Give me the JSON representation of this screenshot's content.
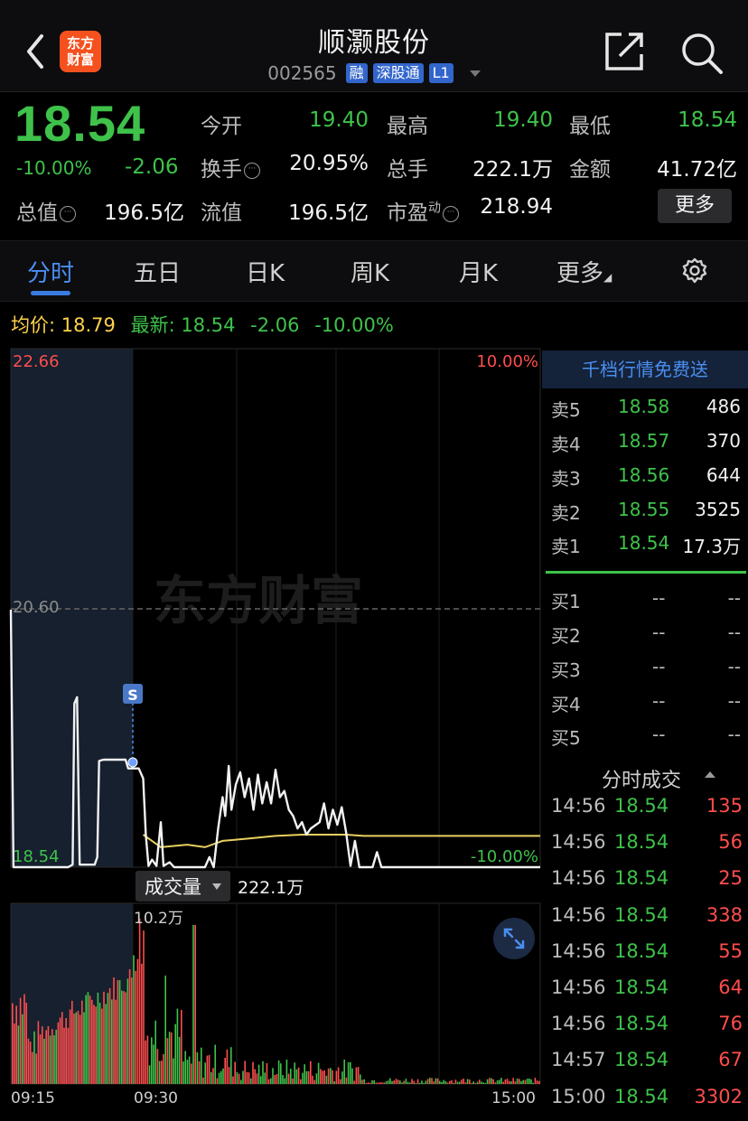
{
  "header": {
    "back_icon": "chevron-left-icon",
    "logo_line1": "东方",
    "logo_line2": "财富",
    "title": "顺灏股份",
    "code": "002565",
    "tags": [
      "融",
      "深股通",
      "L1"
    ],
    "share_icon": "share-icon",
    "search_icon": "search-icon"
  },
  "quote": {
    "price": "18.54",
    "change_pct": "-10.00%",
    "change": "-2.06",
    "open_label": "今开",
    "open": "19.40",
    "high_label": "最高",
    "high": "19.40",
    "low_label": "最低",
    "low": "18.54",
    "turnover_label": "换手",
    "turnover": "20.95%",
    "volume_label": "总手",
    "volume": "222.1万",
    "amount_label": "金额",
    "amount": "41.72亿",
    "mcap_label": "总值",
    "mcap": "196.5亿",
    "float_label": "流值",
    "float_cap": "196.5亿",
    "pe_label": "市盈",
    "pe_sup": "动",
    "pe": "218.94",
    "more_label": "更多"
  },
  "tabs": [
    "分时",
    "五日",
    "日K",
    "周K",
    "月K",
    "更多"
  ],
  "active_tab": "分时",
  "avg_row": {
    "avg_label": "均价:",
    "avg_value": "18.79",
    "latest_label": "最新:",
    "latest_value": "18.54",
    "latest_change": "-2.06",
    "latest_pct": "-10.00%"
  },
  "chart_labels": {
    "top_price": "22.66",
    "mid_price": "20.60",
    "bottom_price": "18.54",
    "top_pct": "10.00%",
    "bottom_pct": "-10.00%",
    "watermark": "东方财富",
    "marker": "S",
    "vol_max": "10.2万",
    "time_start": "09:15",
    "time_open": "09:30",
    "time_end": "15:00",
    "vol_selector": "成交量",
    "vol_total": "222.1万"
  },
  "chart_data": {
    "type": "line",
    "y_range": [
      18.54,
      22.66
    ],
    "prev_close": 20.6,
    "price_series": [
      [
        0,
        20.6
      ],
      [
        0.3,
        18.54
      ],
      [
        6.5,
        18.54
      ],
      [
        7,
        18.56
      ],
      [
        7.2,
        19.85
      ],
      [
        7.5,
        19.9
      ],
      [
        7.8,
        18.56
      ],
      [
        9.5,
        18.56
      ],
      [
        9.8,
        18.62
      ],
      [
        10,
        19.39
      ],
      [
        10.5,
        19.4
      ],
      [
        13,
        19.4
      ],
      [
        13.3,
        19.33
      ],
      [
        14.5,
        19.33
      ],
      [
        15,
        19.25
      ],
      [
        15.3,
        18.8
      ],
      [
        15.6,
        18.55
      ],
      [
        16,
        18.6
      ],
      [
        16.5,
        18.55
      ],
      [
        17,
        18.9
      ],
      [
        17.3,
        18.55
      ],
      [
        18,
        18.58
      ],
      [
        18.5,
        18.54
      ],
      [
        22,
        18.54
      ],
      [
        22.5,
        18.62
      ],
      [
        23,
        18.54
      ],
      [
        23.5,
        18.85
      ],
      [
        24,
        19.1
      ],
      [
        24.3,
        18.95
      ],
      [
        24.7,
        19.35
      ],
      [
        25,
        19.0
      ],
      [
        25.5,
        19.2
      ],
      [
        26,
        19.3
      ],
      [
        26.5,
        19.1
      ],
      [
        27,
        19.25
      ],
      [
        27.5,
        19.0
      ],
      [
        28,
        19.28
      ],
      [
        28.5,
        19.05
      ],
      [
        29,
        19.22
      ],
      [
        29.5,
        19.05
      ],
      [
        30,
        19.32
      ],
      [
        30.5,
        19.1
      ],
      [
        31,
        19.15
      ],
      [
        31.5,
        19.0
      ],
      [
        32,
        18.95
      ],
      [
        32.5,
        18.85
      ],
      [
        33,
        18.9
      ],
      [
        33.5,
        18.8
      ],
      [
        34,
        18.85
      ],
      [
        35,
        18.9
      ],
      [
        35.5,
        19.05
      ],
      [
        36,
        18.85
      ],
      [
        36.5,
        19.0
      ],
      [
        37,
        18.88
      ],
      [
        37.5,
        19.02
      ],
      [
        38,
        18.82
      ],
      [
        38.5,
        18.55
      ],
      [
        39,
        18.75
      ],
      [
        39.5,
        18.54
      ],
      [
        41,
        18.54
      ],
      [
        41.5,
        18.66
      ],
      [
        42,
        18.54
      ],
      [
        60,
        18.54
      ]
    ],
    "avg_series": [
      [
        15,
        18.8
      ],
      [
        17,
        18.7
      ],
      [
        20,
        18.72
      ],
      [
        22,
        18.7
      ],
      [
        24,
        18.75
      ],
      [
        27,
        18.77
      ],
      [
        30,
        18.79
      ],
      [
        33,
        18.8
      ],
      [
        36,
        18.8
      ],
      [
        38,
        18.8
      ],
      [
        40,
        18.79
      ],
      [
        45,
        18.79
      ],
      [
        50,
        18.79
      ],
      [
        60,
        18.79
      ]
    ],
    "volume_series": {
      "unit": "万",
      "max": 10.2
    }
  },
  "order_book": {
    "promo": "千档行情免费送",
    "asks": [
      {
        "label": "卖5",
        "price": "18.58",
        "vol": "486"
      },
      {
        "label": "卖4",
        "price": "18.57",
        "vol": "370"
      },
      {
        "label": "卖3",
        "price": "18.56",
        "vol": "644"
      },
      {
        "label": "卖2",
        "price": "18.55",
        "vol": "3525"
      },
      {
        "label": "卖1",
        "price": "18.54",
        "vol": "17.3万"
      }
    ],
    "bids": [
      {
        "label": "买1",
        "price": "--",
        "vol": "--"
      },
      {
        "label": "买2",
        "price": "--",
        "vol": "--"
      },
      {
        "label": "买3",
        "price": "--",
        "vol": "--"
      },
      {
        "label": "买4",
        "price": "--",
        "vol": "--"
      },
      {
        "label": "买5",
        "price": "--",
        "vol": "--"
      }
    ]
  },
  "trades": {
    "title": "分时成交",
    "rows": [
      {
        "time": "14:56",
        "price": "18.54",
        "vol": "135"
      },
      {
        "time": "14:56",
        "price": "18.54",
        "vol": "56"
      },
      {
        "time": "14:56",
        "price": "18.54",
        "vol": "25"
      },
      {
        "time": "14:56",
        "price": "18.54",
        "vol": "338"
      },
      {
        "time": "14:56",
        "price": "18.54",
        "vol": "55"
      },
      {
        "time": "14:56",
        "price": "18.54",
        "vol": "64"
      },
      {
        "time": "14:56",
        "price": "18.54",
        "vol": "76"
      },
      {
        "time": "14:57",
        "price": "18.54",
        "vol": "67"
      },
      {
        "time": "15:00",
        "price": "18.54",
        "vol": "3302"
      }
    ]
  },
  "colors": {
    "up": "#ff4d4d",
    "down": "#3ec24a",
    "accent": "#3a7be0",
    "avg_line": "#e8d060"
  }
}
